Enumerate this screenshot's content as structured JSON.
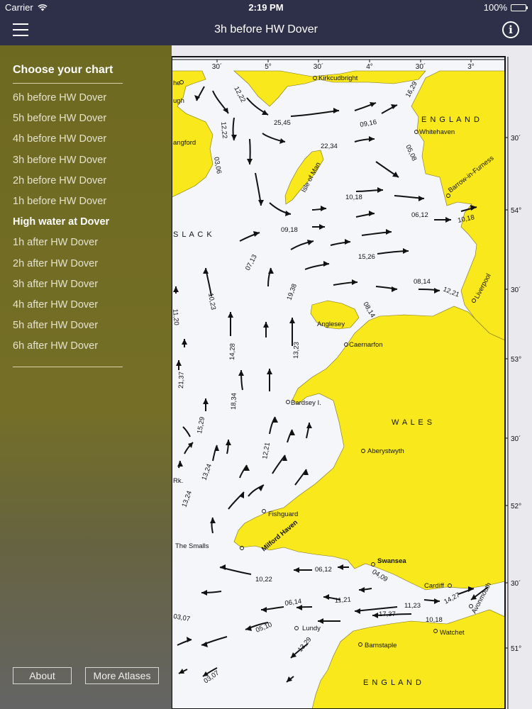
{
  "status_bar": {
    "carrier": "Carrier",
    "time": "2:19 PM",
    "battery": "100%"
  },
  "nav": {
    "title": "3h before HW Dover"
  },
  "drawer": {
    "heading": "Choose your chart",
    "items": [
      "6h before HW Dover",
      "5h before HW Dover",
      "4h before HW Dover",
      "3h before HW Dover",
      "2h before HW Dover",
      "1h before HW Dover",
      "High water at Dover",
      "1h after HW Dover",
      "2h after HW Dover",
      "3h after HW Dover",
      "4h after HW Dover",
      "5h after HW Dover",
      "6h after HW Dover"
    ],
    "selected_index": 6,
    "about_label": "About",
    "more_label": "More Atlases"
  },
  "map": {
    "colors": {
      "land": "#f8e81c",
      "sea": "#f4f6fa",
      "border": "#111111"
    },
    "top_ticks": [
      "30´",
      "5°",
      "30´",
      "4°",
      "30´",
      "3°"
    ],
    "right_ticks": [
      "30´",
      "54°",
      "30´",
      "53°",
      "30´",
      "52°",
      "30´",
      "51°"
    ],
    "regions": [
      "E N G L A N D",
      "W A L E S",
      "E N G L A N D",
      "S L A C K"
    ],
    "places": [
      "Kirkcudbright",
      "Whitehaven",
      "Barrow-in-Furness",
      "Isle of Man",
      "Liverpool",
      "Anglesey",
      "Caernarfon",
      "Bardsey I.",
      "Aberystwyth",
      "Fishguard",
      "Milford Haven",
      "The Smalls",
      "Swansea",
      "Cardiff",
      "Avonmouth",
      "Lundy",
      "Watchet",
      "Barnstaple"
    ],
    "partial_labels": [
      "he",
      "ugh",
      "angford",
      "Rk."
    ],
    "rates": [
      "12,22",
      "25,45",
      "16,29",
      "09,16",
      "12,22",
      "03,06",
      "22,34",
      "05,08",
      "10,18",
      "06,12",
      "10,18",
      "09,18",
      "07,13",
      "15,26",
      "08,14",
      "12,21",
      "10,23",
      "19,38",
      "08,14",
      "11,20",
      "14,28",
      "13,23",
      "21,37",
      "18,34",
      "15,29",
      "12,21",
      "13,24",
      "13,24",
      "06,12",
      "10,22",
      "04,09",
      "06,14",
      "11,21",
      "11,23",
      "14,27",
      "17,37",
      "10,18",
      "03,07",
      "05,10",
      "13,29",
      "03,07"
    ]
  }
}
